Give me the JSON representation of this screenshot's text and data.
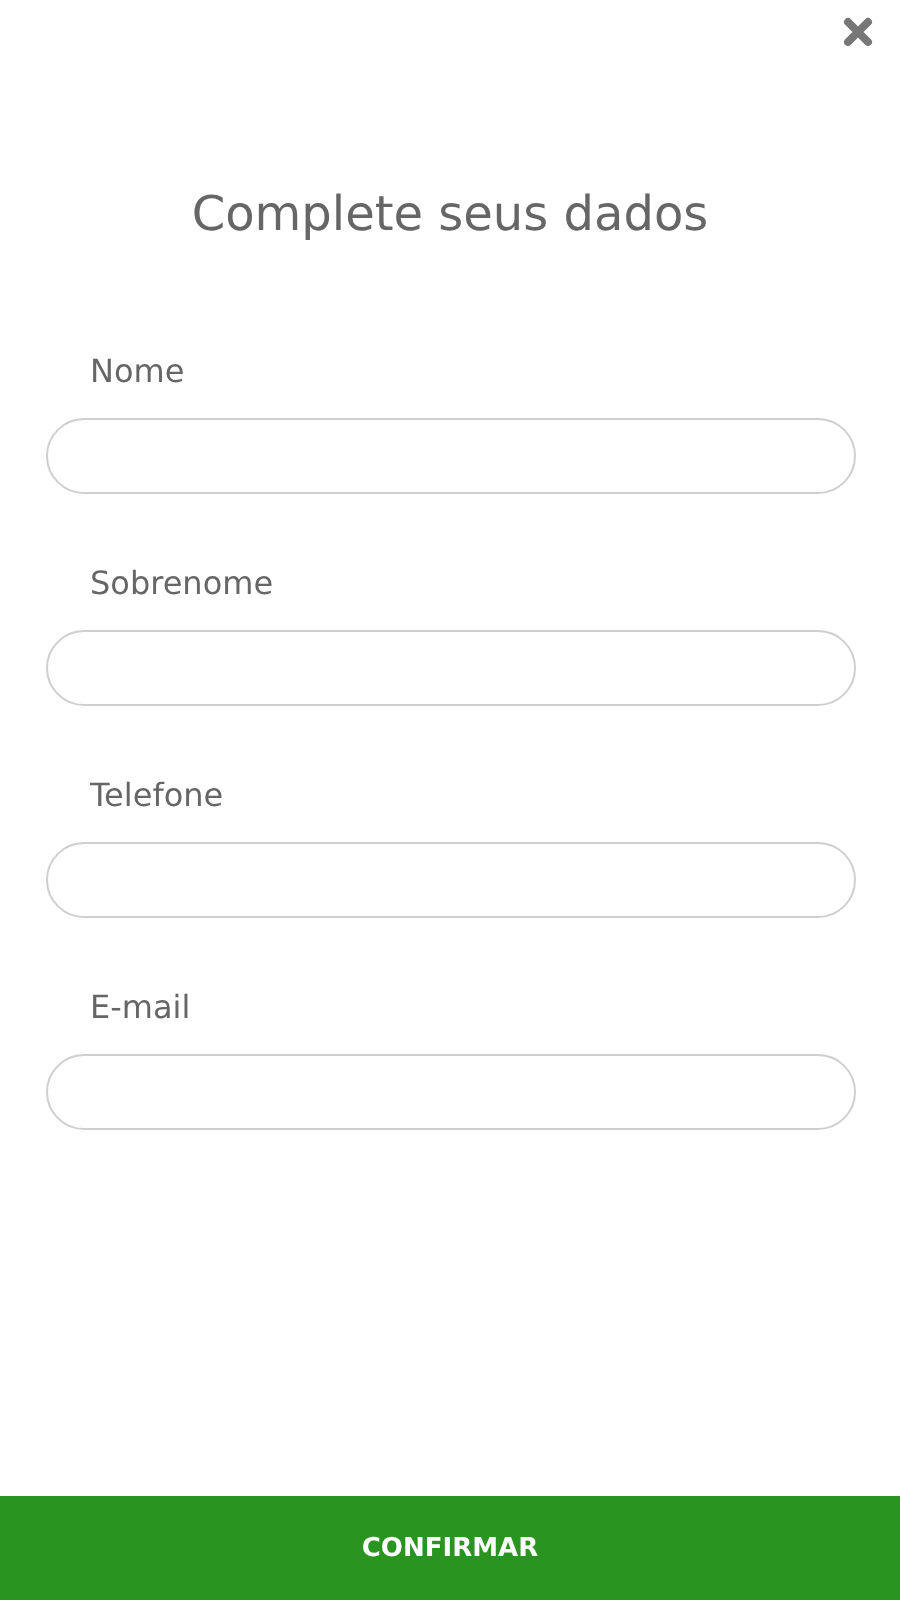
{
  "title": "Complete seus dados",
  "fields": [
    {
      "label": "Nome"
    },
    {
      "label": "Sobrenome"
    },
    {
      "label": "Telefone"
    },
    {
      "label": "E-mail"
    }
  ],
  "confirm_button": "CONFIRMAR"
}
